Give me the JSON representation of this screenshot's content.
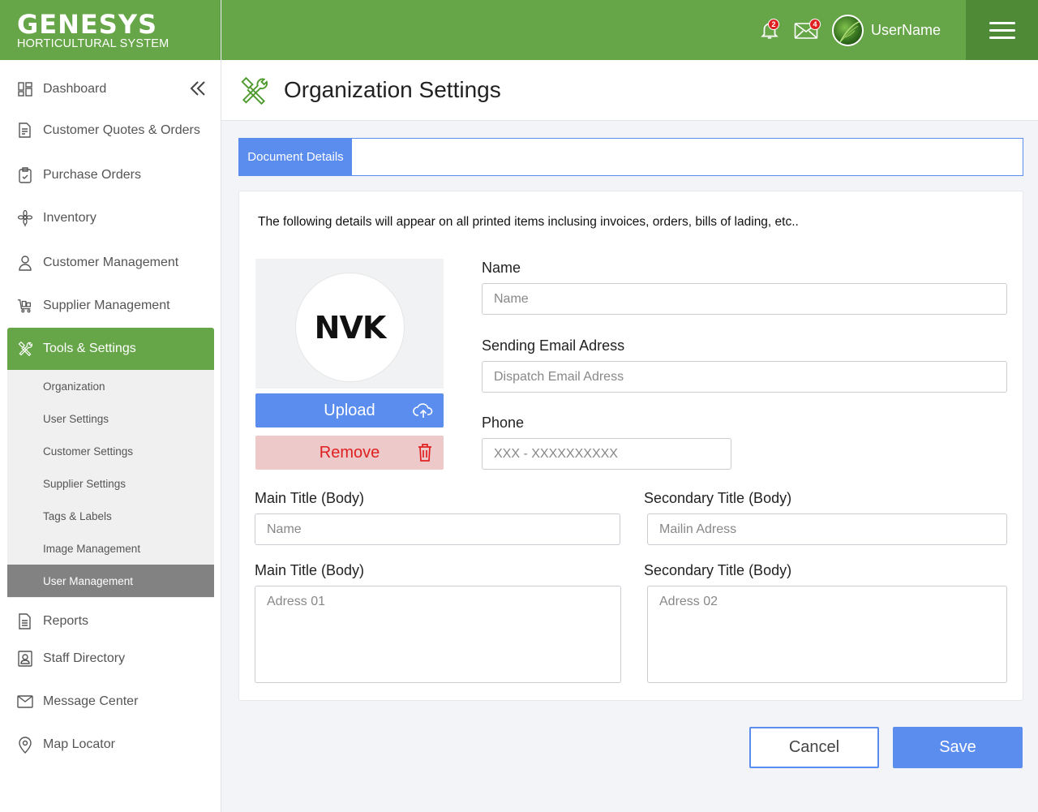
{
  "brand": {
    "logo": "GENESYS",
    "subtitle": "HORTICULTURAL SYSTEM"
  },
  "header": {
    "notifications_count": "2",
    "messages_count": "4",
    "username": "UserName"
  },
  "sidebar": {
    "items": [
      {
        "label": "Dashboard",
        "icon": "dashboard-icon"
      },
      {
        "label": "Customer Quotes & Orders",
        "icon": "document-edit-icon"
      },
      {
        "label": "Purchase Orders",
        "icon": "clipboard-check-icon"
      },
      {
        "label": "Inventory",
        "icon": "flower-icon"
      },
      {
        "label": "Customer Management",
        "icon": "user-icon"
      },
      {
        "label": "Supplier Management",
        "icon": "cart-icon"
      },
      {
        "label": "Tools & Settings",
        "icon": "tools-icon",
        "active": true
      },
      {
        "label": "Reports",
        "icon": "report-icon"
      },
      {
        "label": "Staff Directory",
        "icon": "contact-card-icon"
      },
      {
        "label": "Message Center",
        "icon": "mail-icon"
      },
      {
        "label": "Map Locator",
        "icon": "map-pin-icon"
      }
    ],
    "submenu": [
      {
        "label": "Organization"
      },
      {
        "label": "User Settings"
      },
      {
        "label": "Customer Settings"
      },
      {
        "label": "Supplier Settings"
      },
      {
        "label": "Tags & Labels"
      },
      {
        "label": "Image Management"
      },
      {
        "label": "User Management",
        "selected": true
      }
    ]
  },
  "page": {
    "title": "Organization Settings",
    "icon": "tools-icon"
  },
  "tabs": [
    {
      "label": "Document Details",
      "active": true
    }
  ],
  "form": {
    "intro": "The following details will appear on all printed items inclusing invoices, orders, bills of lading, etc..",
    "logo_text": "NVK",
    "upload_label": "Upload",
    "remove_label": "Remove",
    "name_label": "Name",
    "name_placeholder": "Name",
    "email_label": "Sending Email Adress",
    "email_placeholder": "Dispatch Email Adress",
    "phone_label": "Phone",
    "phone_placeholder": "XXX - XXXXXXXXXX",
    "main_title_label": "Main Title (Body)",
    "main_title_placeholder": "Name",
    "secondary_title_label": "Secondary Title (Body)",
    "secondary_title_placeholder": "Mailin Adress",
    "main_title2_label": "Main Title (Body)",
    "address1_placeholder": "Adress 01",
    "secondary_title2_label": "Secondary Title (Body)",
    "address2_placeholder": "Adress 02"
  },
  "actions": {
    "cancel_label": "Cancel",
    "save_label": "Save"
  },
  "colors": {
    "brand_green": "#66a548",
    "dark_green": "#4f8a36",
    "accent_blue": "#5b8def",
    "danger_red": "#e02020",
    "danger_bg": "#edc9c9"
  }
}
